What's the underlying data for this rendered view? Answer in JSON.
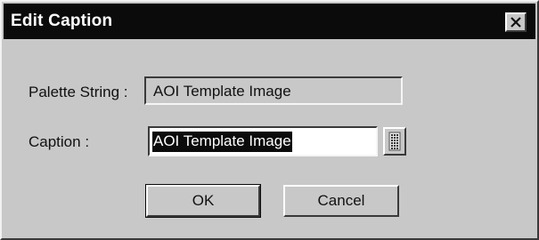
{
  "dialog": {
    "title": "Edit Caption",
    "close_icon": "close-icon"
  },
  "palette_string": {
    "label": "Palette String :",
    "value": "AOI Template Image"
  },
  "caption": {
    "label": "Caption :",
    "value": "AOI Template Image",
    "picker_icon": "grid-icon"
  },
  "buttons": {
    "ok_label": "OK",
    "cancel_label": "Cancel"
  },
  "colors": {
    "face": "#c8c8c8",
    "title_bar": "#0b0b0b",
    "selection": "#0b0b0b",
    "text": "#111111"
  }
}
